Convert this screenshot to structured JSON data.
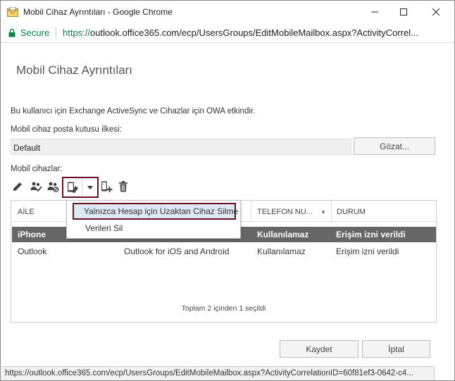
{
  "window": {
    "title": "Mobil Cihaz Ayrıntıları - Google Chrome"
  },
  "address_bar": {
    "secure_label": "Secure",
    "url_scheme": "https://",
    "url_rest": "outlook.office365.com/ecp/UsersGroups/EditMobileMailbox.aspx?ActivityCorrel..."
  },
  "page": {
    "title": "Mobil Cihaz Ayrıntıları",
    "description": "Bu kullanıcı için Exchange ActiveSync ve Cihazlar için OWA etkindir.",
    "policy_label": "Mobil cihaz posta kutusu ilkesi:",
    "policy_value": "Default",
    "browse_label": "Gözat...",
    "devices_label": "Mobil cihazlar:"
  },
  "grid": {
    "columns": [
      "AİLE",
      "TELEFON NU...",
      "DURUM"
    ],
    "rows": [
      {
        "family": "iPhone",
        "model": "",
        "phone": "Kullanılamaz",
        "status": "Erişim izni verildi"
      },
      {
        "family": "Outlook",
        "model": "Outlook for iOS and Android",
        "phone": "Kullanılamaz",
        "status": "Erişim izni verildi"
      }
    ],
    "footer": "Toplam 2 içinden 1 seçildi"
  },
  "dropdown": {
    "item_account_wipe": "Yalnızca Hesap için Uzaktan Cihaz Silme",
    "item_wipe_data": "Verileri Sil"
  },
  "buttons": {
    "save": "Kaydet",
    "cancel": "İptal"
  },
  "status_bar": {
    "url": "https://outlook.office365.com/ecp/UsersGroups/EditMobileMailbox.aspx?ActivityCorrelationID=60f81ef3-0642-c4..."
  },
  "colors": {
    "highlight_border": "#6b1020",
    "selected_row": "#666666",
    "secure_green": "#0b8043",
    "dropdown_hover": "#dde8f4"
  }
}
